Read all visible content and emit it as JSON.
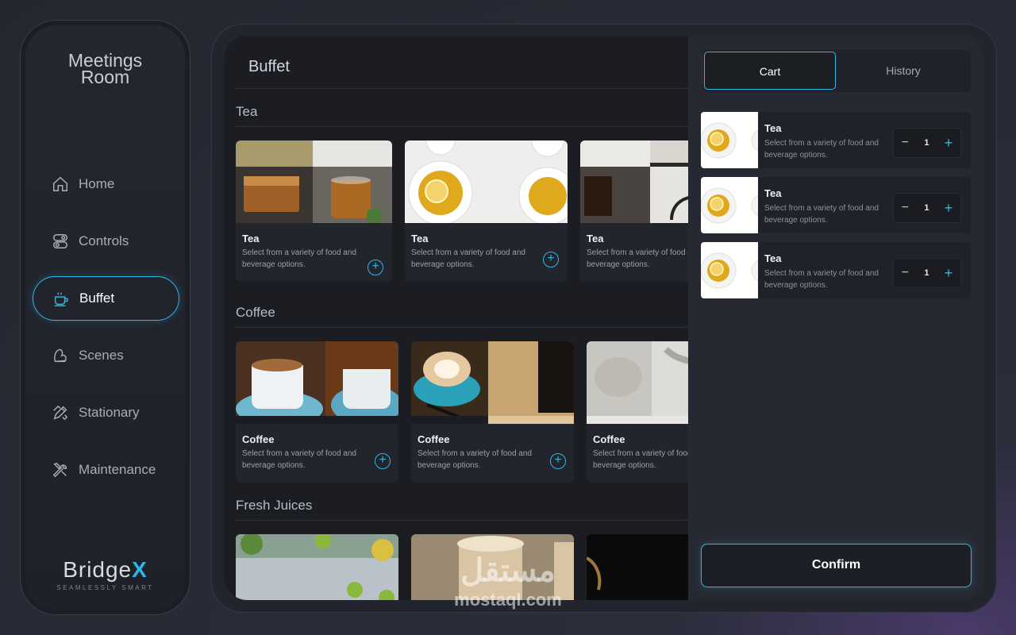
{
  "sidebar": {
    "title_line1": "Meetings",
    "title_line2": "Room",
    "items": [
      {
        "label": "Home",
        "icon": "home-icon"
      },
      {
        "label": "Controls",
        "icon": "toggle-icon"
      },
      {
        "label": "Buffet",
        "icon": "cup-icon"
      },
      {
        "label": "Scenes",
        "icon": "scenes-icon"
      },
      {
        "label": "Stationary",
        "icon": "pencil-ruler-icon"
      },
      {
        "label": "Maintenance",
        "icon": "tools-icon"
      }
    ],
    "active_index": 2,
    "logo_main": "Bridge",
    "logo_x": "X",
    "logo_tagline": "SEAMLESSLY SMART"
  },
  "content": {
    "title": "Buffet",
    "sections": [
      {
        "title": "Tea",
        "cards": [
          {
            "title": "Tea",
            "desc": "Select from a variety of food and beverage options."
          },
          {
            "title": "Tea",
            "desc": "Select from a variety of food and beverage options."
          },
          {
            "title": "Tea",
            "desc": "Select from a variety of food and beverage options."
          }
        ]
      },
      {
        "title": "Coffee",
        "cards": [
          {
            "title": "Coffee",
            "desc": "Select from a variety of food and beverage options."
          },
          {
            "title": "Coffee",
            "desc": "Select from a variety of food and beverage options."
          },
          {
            "title": "Coffee",
            "desc": "Select from a variety of food and beverage options."
          }
        ]
      },
      {
        "title": "Fresh Juices",
        "cards": []
      }
    ]
  },
  "cart": {
    "tabs": [
      "Cart",
      "History"
    ],
    "active_tab": 0,
    "items": [
      {
        "title": "Tea",
        "desc": "Select from a variety of food and beverage options.",
        "qty": "1"
      },
      {
        "title": "Tea",
        "desc": "Select from a variety of food and beverage options.",
        "qty": "1"
      },
      {
        "title": "Tea",
        "desc": "Select from a variety of food and beverage options.",
        "qty": "1"
      }
    ],
    "minus": "−",
    "plus": "+",
    "confirm_label": "Confirm"
  },
  "add_symbol": "+",
  "watermark": {
    "arabic": "مستقل",
    "latin": "mostaql.com"
  },
  "colors": {
    "accent": "#2fb6e6",
    "background": "#282b36",
    "panel": "#1b1d23"
  }
}
